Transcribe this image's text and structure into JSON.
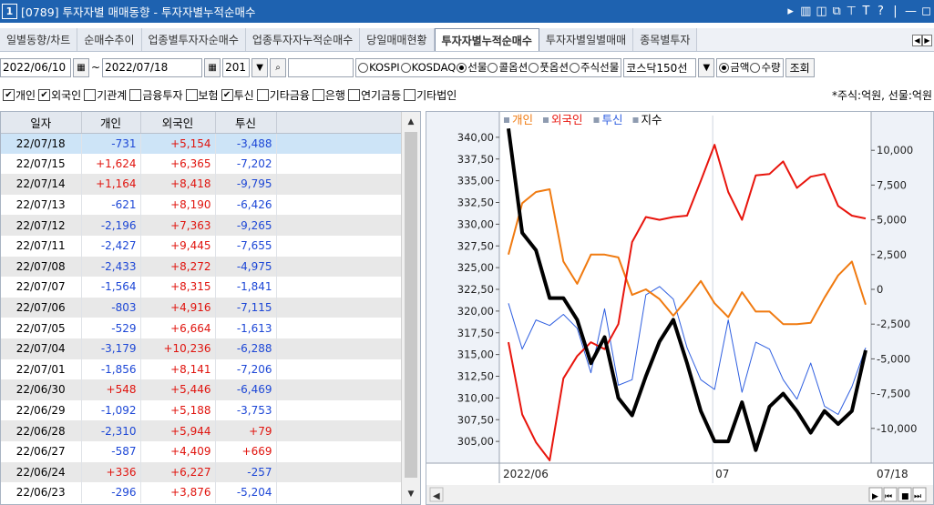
{
  "window": {
    "number": "1",
    "title": "[0789] 투자자별 매매동향 - 투자자별누적순매수",
    "icons": [
      "▸",
      "▥",
      "◫",
      "⧉",
      "⊤",
      "T",
      "?",
      "|",
      "—",
      "◻"
    ]
  },
  "tabs": [
    {
      "label": "일별동향/차트",
      "active": false
    },
    {
      "label": "순매수추이",
      "active": false
    },
    {
      "label": "업종별투자자순매수",
      "active": false
    },
    {
      "label": "업종투자자누적순매수",
      "active": false
    },
    {
      "label": "당일매매현황",
      "active": false
    },
    {
      "label": "투자자별누적순매수",
      "active": true
    },
    {
      "label": "투자자별일별매매",
      "active": false
    },
    {
      "label": "종목별투자",
      "active": false
    }
  ],
  "toolbar": {
    "start_date": "2022/06/10",
    "tilde": "~",
    "end_date": "2022/07/18",
    "count": "201",
    "search_value": "",
    "market_options": [
      {
        "label": "KOSPI",
        "selected": false
      },
      {
        "label": "KOSDAQ",
        "selected": false
      },
      {
        "label": "선물",
        "selected": true
      },
      {
        "label": "콜옵션",
        "selected": false
      },
      {
        "label": "풋옵션",
        "selected": false
      },
      {
        "label": "주식선물",
        "selected": false
      }
    ],
    "index_select": "코스닥150선",
    "measure_options": [
      {
        "label": "금액",
        "selected": true
      },
      {
        "label": "수량",
        "selected": false
      }
    ],
    "query_label": "조회"
  },
  "investor_filters": [
    {
      "label": "개인",
      "checked": true
    },
    {
      "label": "외국인",
      "checked": true
    },
    {
      "label": "기관계",
      "checked": false
    },
    {
      "label": "금융투자",
      "checked": false
    },
    {
      "label": "보험",
      "checked": false
    },
    {
      "label": "투신",
      "checked": true
    },
    {
      "label": "기타금융",
      "checked": false
    },
    {
      "label": "은행",
      "checked": false
    },
    {
      "label": "연기금등",
      "checked": false
    },
    {
      "label": "기타법인",
      "checked": false
    }
  ],
  "unit_note": "*주식:억원, 선물:억원",
  "table": {
    "headers": [
      "일자",
      "개인",
      "외국인",
      "투신"
    ],
    "rows": [
      [
        "22/07/18",
        "-731",
        "+5,154",
        "-3,488"
      ],
      [
        "22/07/15",
        "+1,624",
        "+6,365",
        "-7,202"
      ],
      [
        "22/07/14",
        "+1,164",
        "+8,418",
        "-9,795"
      ],
      [
        "22/07/13",
        "-621",
        "+8,190",
        "-6,426"
      ],
      [
        "22/07/12",
        "-2,196",
        "+7,363",
        "-9,265"
      ],
      [
        "22/07/11",
        "-2,427",
        "+9,445",
        "-7,655"
      ],
      [
        "22/07/08",
        "-2,433",
        "+8,272",
        "-4,975"
      ],
      [
        "22/07/07",
        "-1,564",
        "+8,315",
        "-1,841"
      ],
      [
        "22/07/06",
        "-803",
        "+4,916",
        "-7,115"
      ],
      [
        "22/07/05",
        "-529",
        "+6,664",
        "-1,613"
      ],
      [
        "22/07/04",
        "-3,179",
        "+10,236",
        "-6,288"
      ],
      [
        "22/07/01",
        "-1,856",
        "+8,141",
        "-7,206"
      ],
      [
        "22/06/30",
        "+548",
        "+5,446",
        "-6,469"
      ],
      [
        "22/06/29",
        "-1,092",
        "+5,188",
        "-3,753"
      ],
      [
        "22/06/28",
        "-2,310",
        "+5,944",
        "+79"
      ],
      [
        "22/06/27",
        "-587",
        "+4,409",
        "+669"
      ],
      [
        "22/06/24",
        "+336",
        "+6,227",
        "-257"
      ],
      [
        "22/06/23",
        "-296",
        "+3,876",
        "-5,204"
      ]
    ]
  },
  "chart_data": {
    "type": "line",
    "legend": [
      {
        "name": "개인",
        "color": "#f07a10"
      },
      {
        "name": "외국인",
        "color": "#e8150d"
      },
      {
        "name": "투신",
        "color": "#2f5fe0"
      },
      {
        "name": "지수",
        "color": "#000000"
      }
    ],
    "x_labels": [
      "2022/06",
      "07",
      "07/18"
    ],
    "left_axis": {
      "ylim": [
        302.5,
        342.5
      ],
      "ticks": [
        "340,00",
        "337,50",
        "335,00",
        "332,50",
        "330,00",
        "327,50",
        "325,00",
        "322,50",
        "320,00",
        "317,50",
        "315,00",
        "312,50",
        "310,00",
        "307,50",
        "305,00"
      ]
    },
    "right_axis": {
      "ylim": [
        -12500,
        12500
      ],
      "ticks": [
        "10,000",
        "7,500",
        "5,000",
        "2,500",
        "0",
        "-2,500",
        "-5,000",
        "-7,500",
        "-10,000"
      ]
    },
    "series": [
      {
        "name": "지수",
        "axis": "left",
        "color": "#000000",
        "values": [
          341.0,
          329.0,
          327.0,
          321.5,
          321.5,
          319.0,
          314.0,
          317.0,
          310.0,
          308.0,
          312.5,
          316.5,
          319.0,
          314.0,
          308.5,
          305.0,
          305.0,
          309.5,
          304.0,
          309.0,
          310.5,
          308.5,
          306.0,
          308.5,
          307.0,
          308.5,
          315.5
        ]
      },
      {
        "name": "개인",
        "axis": "right",
        "color": "#f07a10",
        "values": [
          2500,
          6200,
          7000,
          7200,
          2000,
          400,
          2500,
          2500,
          2300,
          -400,
          0,
          -700,
          -1900,
          -700,
          600,
          -1000,
          -2000,
          -200,
          -1600,
          -1600,
          -2500,
          -2500,
          -2400,
          -600,
          1000,
          2000,
          -1100
        ]
      },
      {
        "name": "외국인",
        "axis": "right",
        "color": "#e8150d",
        "values": [
          -3800,
          -9000,
          -11000,
          -12300,
          -6400,
          -4800,
          -3800,
          -4300,
          -2500,
          3400,
          5200,
          5000,
          5200,
          5300,
          7800,
          10400,
          7000,
          5000,
          8200,
          8300,
          9200,
          7300,
          8100,
          8300,
          6000,
          5300,
          5100
        ]
      },
      {
        "name": "투신",
        "axis": "right",
        "color": "#2f5fe0",
        "values": [
          -1000,
          -4300,
          -2200,
          -2600,
          -1800,
          -2800,
          -6000,
          -1400,
          -6900,
          -6500,
          -400,
          200,
          -700,
          -4200,
          -6500,
          -7200,
          -2200,
          -7400,
          -3800,
          -4300,
          -6500,
          -7900,
          -5300,
          -8400,
          -9000,
          -7000,
          -4200
        ]
      }
    ]
  }
}
